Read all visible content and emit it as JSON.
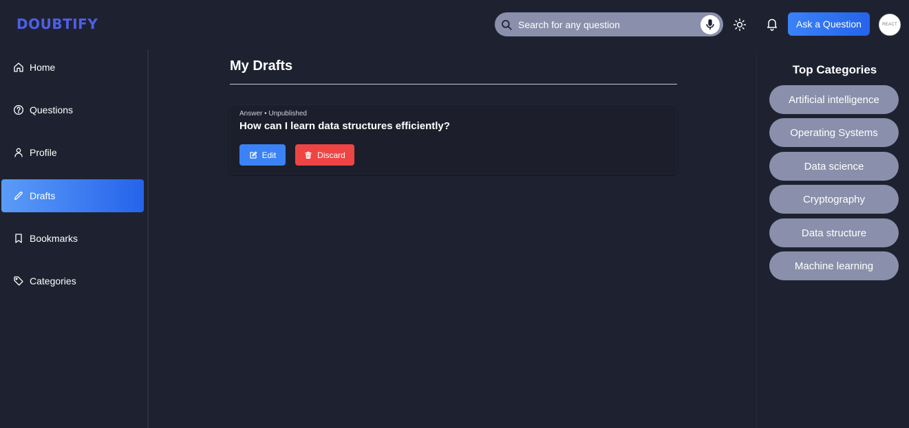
{
  "header": {
    "logo": "DOUBTIFY",
    "search": {
      "placeholder": "Search for any question",
      "icon": "search-icon",
      "mic_icon": "microphone-icon"
    },
    "theme_icon": "sun-icon",
    "notification_icon": "bell-icon",
    "ask_label": "Ask a Question",
    "avatar_text": "REACT"
  },
  "sidebar": {
    "items": [
      {
        "label": "Home",
        "icon": "home-icon",
        "active": false
      },
      {
        "label": "Questions",
        "icon": "question-circle-icon",
        "active": false
      },
      {
        "label": "Profile",
        "icon": "user-icon",
        "active": false
      },
      {
        "label": "Drafts",
        "icon": "pencil-icon",
        "active": true
      },
      {
        "label": "Bookmarks",
        "icon": "bookmark-icon",
        "active": false
      },
      {
        "label": "Categories",
        "icon": "tag-icon",
        "active": false
      }
    ]
  },
  "main": {
    "title": "My Drafts",
    "drafts": [
      {
        "meta": "Answer • Unpublished",
        "title": "How can I learn data structures efficiently?",
        "edit_label": "Edit",
        "discard_label": "Discard"
      }
    ]
  },
  "right": {
    "title": "Top Categories",
    "categories": [
      "Artificial intelligence",
      "Operating Systems",
      "Data science",
      "Cryptography",
      "Data structure",
      "Machine learning"
    ]
  },
  "colors": {
    "background": "#1e2230",
    "accent": "#3b82f6",
    "logo": "#4f5ee8",
    "danger": "#ef4444",
    "pill": "#8a90ab"
  }
}
